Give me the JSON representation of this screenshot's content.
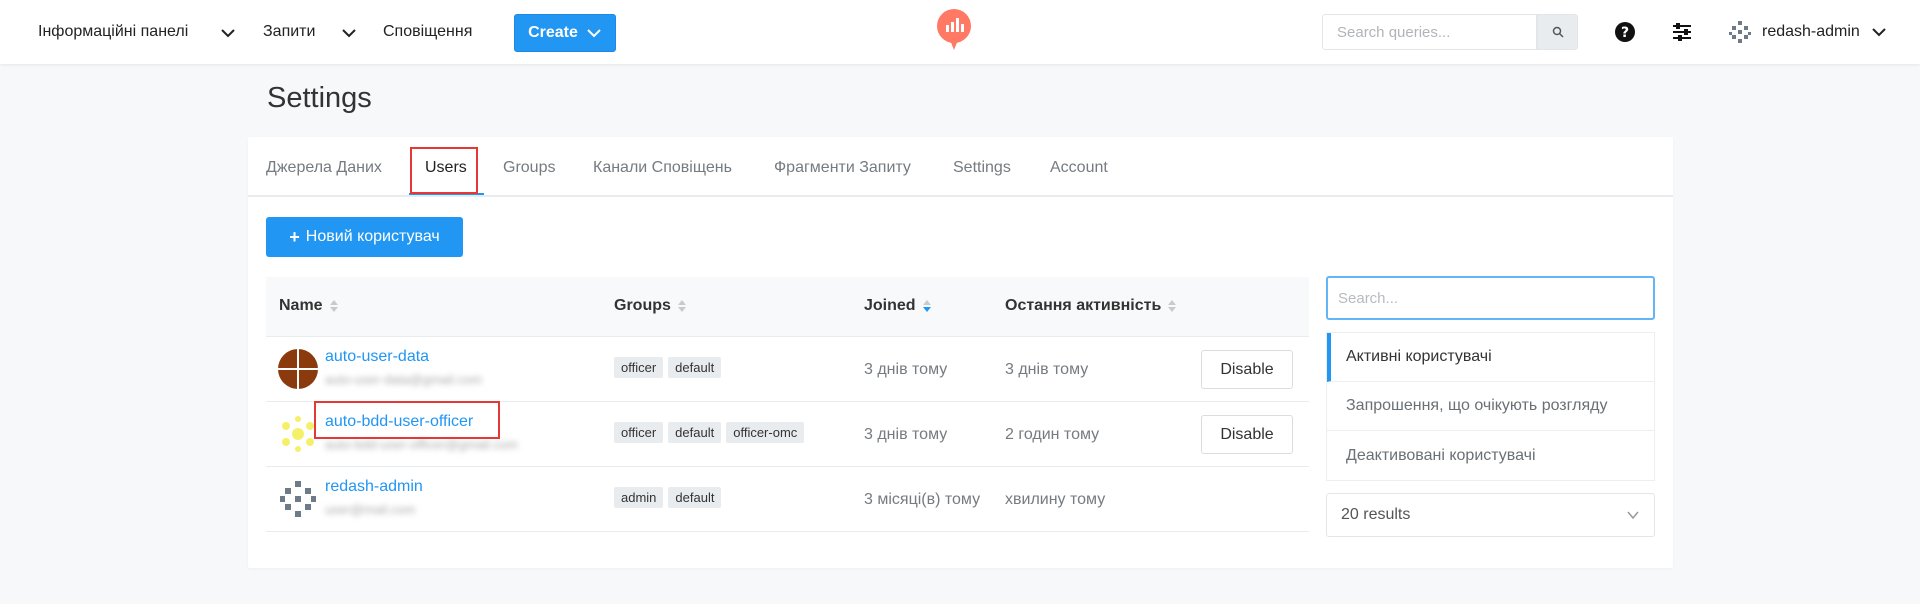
{
  "nav": {
    "dashboards_label": "Інформаційні панелі",
    "queries_label": "Запити",
    "alerts_label": "Сповіщення",
    "create_label": "Create",
    "search_placeholder": "Search queries...",
    "username": "redash-admin"
  },
  "page": {
    "title": "Settings"
  },
  "tabs": [
    {
      "label": "Джерела Даних"
    },
    {
      "label": "Users"
    },
    {
      "label": "Groups"
    },
    {
      "label": "Канали Сповіщень"
    },
    {
      "label": "Фрагменти Запиту"
    },
    {
      "label": "Settings"
    },
    {
      "label": "Account"
    }
  ],
  "new_user_label": "Новий користувач",
  "table": {
    "headers": {
      "name": "Name",
      "groups": "Groups",
      "joined": "Joined",
      "last_active": "Остання активність"
    },
    "rows": [
      {
        "name": "auto-user-data",
        "email": "auto-user-data@gmail.com",
        "groups": [
          "officer",
          "default"
        ],
        "joined": "3 днів тому",
        "last_active": "3 днів тому",
        "action": "Disable"
      },
      {
        "name": "auto-bdd-user-officer",
        "email": "auto-bdd-user-officer@gmail.com",
        "groups": [
          "officer",
          "default",
          "officer-omc"
        ],
        "joined": "3 днів тому",
        "last_active": "2 годин тому",
        "action": "Disable"
      },
      {
        "name": "redash-admin",
        "email": "user@mail.com",
        "groups": [
          "admin",
          "default"
        ],
        "joined": "3 місяці(в) тому",
        "last_active": "хвилину тому",
        "action": ""
      }
    ]
  },
  "sidebar": {
    "search_placeholder": "Search...",
    "filters": [
      {
        "label": "Активні користувачі"
      },
      {
        "label": "Запрошення, що очікують розгляду"
      },
      {
        "label": "Деактивовані користувачі"
      }
    ],
    "results_label": "20 results"
  },
  "colors": {
    "accent": "#2196f3",
    "highlight": "#e53935",
    "logo": "#ff7964"
  }
}
